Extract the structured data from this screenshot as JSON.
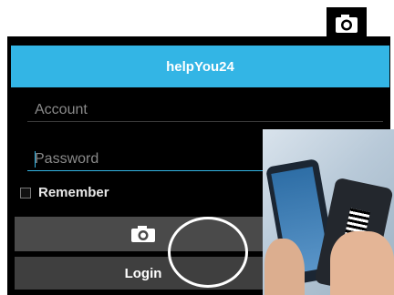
{
  "app": {
    "title": "helpYou24"
  },
  "form": {
    "account_placeholder": "Account",
    "password_placeholder": "Password",
    "remember_label": "Remember",
    "remember_checked": false,
    "login_label": "Login"
  },
  "icons": {
    "corner": "camera-icon",
    "button": "camera-icon"
  },
  "colors": {
    "accent": "#33b5e5",
    "background": "#000000",
    "button": "#4a4a4a",
    "text": "#ffffff"
  }
}
